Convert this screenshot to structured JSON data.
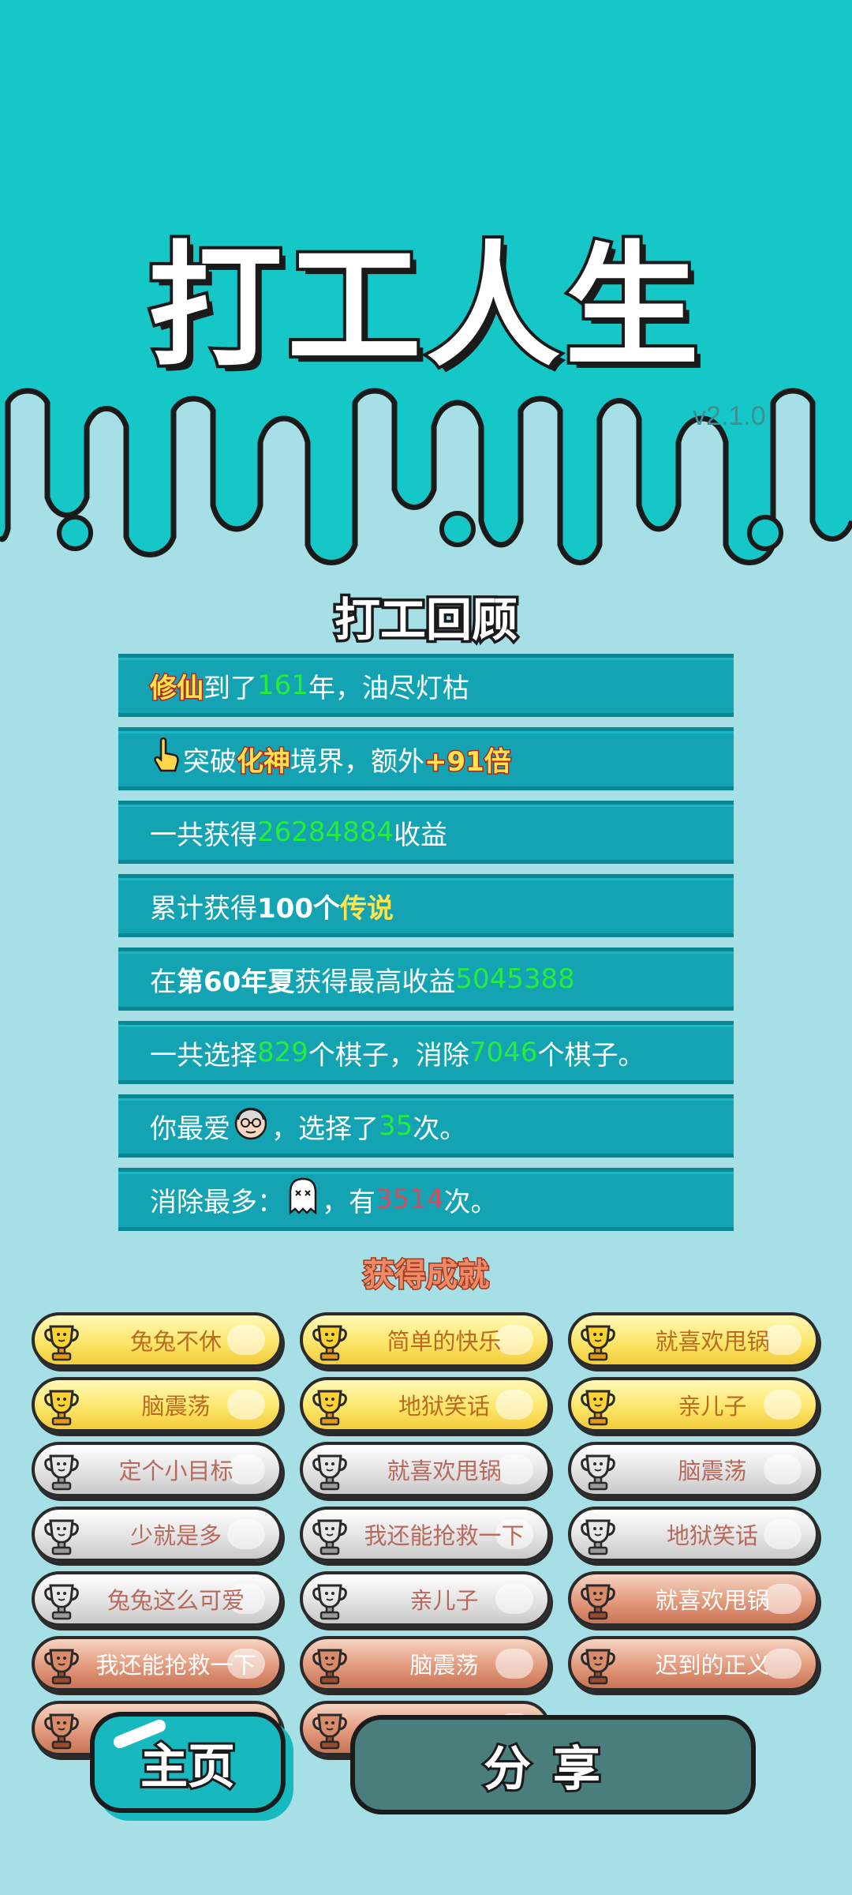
{
  "header": {
    "title": "打工人生",
    "version": "v2.1.0"
  },
  "review": {
    "title": "打工回顾",
    "rows": [
      {
        "parts": [
          {
            "t": "修仙",
            "c": "gold"
          },
          {
            "t": "到了"
          },
          {
            "t": "161",
            "c": "g"
          },
          {
            "t": "年，油尽灯枯"
          }
        ]
      },
      {
        "icon": "hand-pointer-icon",
        "parts": [
          {
            "t": "突破"
          },
          {
            "t": "化神",
            "c": "gold"
          },
          {
            "t": "境界，额外"
          },
          {
            "t": "+91倍",
            "c": "gold"
          }
        ]
      },
      {
        "parts": [
          {
            "t": "一共获得"
          },
          {
            "t": "26284884",
            "c": "g"
          },
          {
            "t": "收益"
          }
        ]
      },
      {
        "parts": [
          {
            "t": "累计获得"
          },
          {
            "t": "100个",
            "c": "b"
          },
          {
            "t": "传说",
            "c": "ye"
          }
        ]
      },
      {
        "parts": [
          {
            "t": "在 "
          },
          {
            "t": "第60年夏",
            "c": "b"
          },
          {
            "t": " 获得最高收益"
          },
          {
            "t": "5045388",
            "c": "g"
          }
        ]
      },
      {
        "parts": [
          {
            "t": "一共选择"
          },
          {
            "t": "829",
            "c": "g"
          },
          {
            "t": "个棋子，消除"
          },
          {
            "t": "7046",
            "c": "g"
          },
          {
            "t": "个棋子。"
          }
        ]
      },
      {
        "parts": [
          {
            "t": "你最爱"
          },
          {
            "icon": "old-man-face-icon"
          },
          {
            "t": "，选择了"
          },
          {
            "t": "35",
            "c": "g"
          },
          {
            "t": "次。"
          }
        ]
      },
      {
        "parts": [
          {
            "t": "消除最多："
          },
          {
            "icon": "ghost-icon"
          },
          {
            "t": "，有"
          },
          {
            "t": "3514",
            "c": "r"
          },
          {
            "t": "次。"
          }
        ]
      }
    ]
  },
  "achievements": {
    "title": "获得成就",
    "items": [
      {
        "label": "兔兔不休",
        "tier": "gold"
      },
      {
        "label": "简单的快乐",
        "tier": "gold"
      },
      {
        "label": "就喜欢甩锅",
        "tier": "gold"
      },
      {
        "label": "脑震荡",
        "tier": "gold"
      },
      {
        "label": "地狱笑话",
        "tier": "gold"
      },
      {
        "label": "亲儿子",
        "tier": "gold"
      },
      {
        "label": "定个小目标",
        "tier": "silver"
      },
      {
        "label": "就喜欢甩锅",
        "tier": "silver"
      },
      {
        "label": "脑震荡",
        "tier": "silver"
      },
      {
        "label": "少就是多",
        "tier": "silver"
      },
      {
        "label": "我还能抢救一下",
        "tier": "silver"
      },
      {
        "label": "地狱笑话",
        "tier": "silver"
      },
      {
        "label": "兔兔这么可爱",
        "tier": "silver"
      },
      {
        "label": "亲儿子",
        "tier": "silver"
      },
      {
        "label": "就喜欢甩锅",
        "tier": "bronze"
      },
      {
        "label": "我还能抢救一下",
        "tier": "bronze"
      },
      {
        "label": "脑震荡",
        "tier": "bronze"
      },
      {
        "label": "迟到的正义",
        "tier": "bronze"
      },
      {
        "label": "",
        "tier": "bronze"
      },
      {
        "label": "",
        "tier": "bronze"
      }
    ]
  },
  "buttons": {
    "home": "主页",
    "share": "分享"
  },
  "colors": {
    "header_bg": "#16c7c7",
    "page_bg": "#a6dfe6",
    "row_bg": "#13a3b3",
    "highlight_green": "#27ec3a"
  }
}
